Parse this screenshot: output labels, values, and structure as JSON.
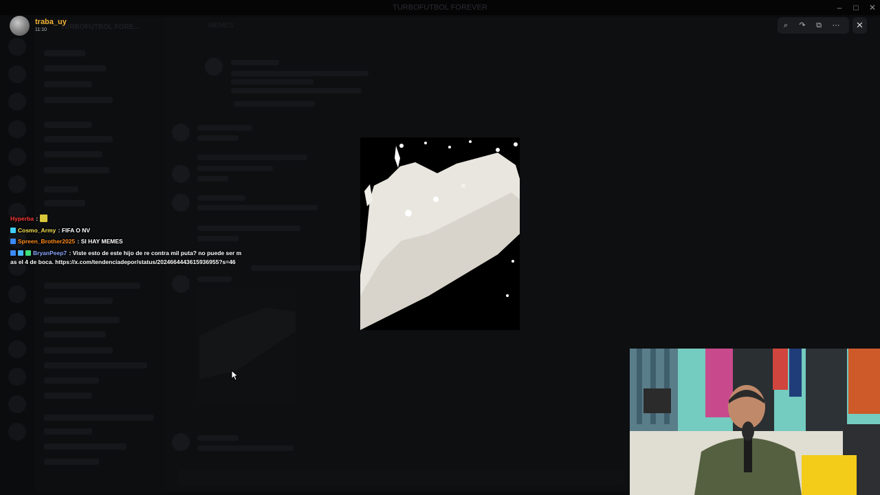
{
  "window": {
    "title": "TURBOFUTBOL FOREVER",
    "controls": {
      "minimize": "–",
      "maximize": "□",
      "close": "✕"
    }
  },
  "background": {
    "server_name": "TURBOFUTBOL FORE...",
    "channel_header": "MEMES"
  },
  "viewer": {
    "username": "traba_uy",
    "time": "11:10",
    "toolbar": [
      {
        "name": "zoom-icon",
        "glyph": "⌕"
      },
      {
        "name": "forward-icon",
        "glyph": "↷"
      },
      {
        "name": "open-external-icon",
        "glyph": "⧉"
      },
      {
        "name": "more-icon",
        "glyph": "⋯"
      }
    ],
    "close_glyph": "✕"
  },
  "stream_chat": [
    {
      "user": "Hyperba",
      "color": "#ff3b3b",
      "badges": [],
      "sep": " :",
      "message": "",
      "emote": true
    },
    {
      "user": "Cosmo_Army",
      "color": "#f5e050",
      "badges": [
        "#3fd0ff"
      ],
      "sep": " : ",
      "message": "FIFA O NV"
    },
    {
      "user": "Spreen_Brother2025",
      "color": "#ff8c1a",
      "badges": [
        "#3b8bff"
      ],
      "sep": " : ",
      "message": "SI HAY MEMES"
    },
    {
      "user": "BryanPeep7",
      "color": "#8aa8ff",
      "badges": [
        "#3b8bff",
        "#4ab8ff",
        "#3fe07a"
      ],
      "sep": " : ",
      "message": "Viste esto de este hijo de re contra mil puta? no puede ser mas el 4 de boca. https://x.com/tendenciadepor/status/2024664443615936955?s=46"
    }
  ],
  "colors": {
    "accent_username": "#f0b232",
    "toolbar_bg": "#1b1c1f"
  }
}
